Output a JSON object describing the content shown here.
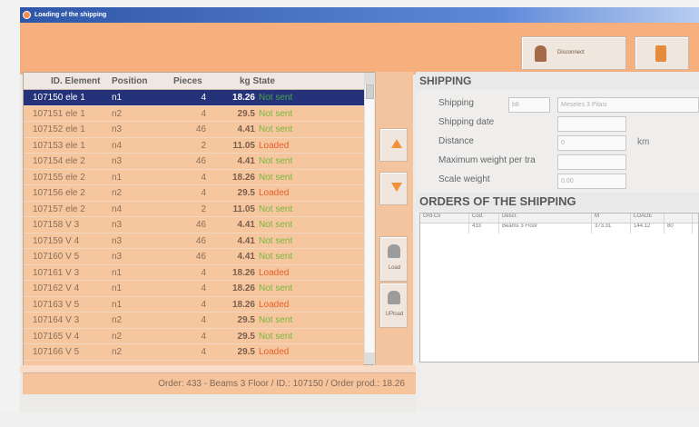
{
  "window": {
    "title": "Loading of the shipping"
  },
  "toolbar": {
    "disconnect_label": "Disconnect",
    "disconnect_icon": "disconnect-icon",
    "exit_icon": "exit-icon"
  },
  "grid": {
    "headers": [
      "ID. Element",
      "Position",
      "Pieces",
      "kg State"
    ],
    "rows": [
      {
        "id": "107150 ele 1",
        "pos": "n1",
        "pieces": "4",
        "kg": "18.26",
        "state": "Not sent",
        "selected": true
      },
      {
        "id": "107151 ele 1",
        "pos": "n2",
        "pieces": "4",
        "kg": "29.5",
        "state": "Not sent"
      },
      {
        "id": "107152 ele 1",
        "pos": "n3",
        "pieces": "46",
        "kg": "4.41",
        "state": "Not sent"
      },
      {
        "id": "107153 ele 1",
        "pos": "n4",
        "pieces": "2",
        "kg": "11.05",
        "state": "Loaded"
      },
      {
        "id": "107154 ele 2",
        "pos": "n3",
        "pieces": "46",
        "kg": "4.41",
        "state": "Not sent"
      },
      {
        "id": "107155 ele 2",
        "pos": "n1",
        "pieces": "4",
        "kg": "18.26",
        "state": "Not sent"
      },
      {
        "id": "107156 ele 2",
        "pos": "n2",
        "pieces": "4",
        "kg": "29.5",
        "state": "Loaded"
      },
      {
        "id": "107157 ele 2",
        "pos": "n4",
        "pieces": "2",
        "kg": "11.05",
        "state": "Not sent"
      },
      {
        "id": "107158 V 3",
        "pos": "n3",
        "pieces": "46",
        "kg": "4.41",
        "state": "Not sent"
      },
      {
        "id": "107159 V 4",
        "pos": "n3",
        "pieces": "46",
        "kg": "4.41",
        "state": "Not sent"
      },
      {
        "id": "107160 V 5",
        "pos": "n3",
        "pieces": "46",
        "kg": "4.41",
        "state": "Not sent"
      },
      {
        "id": "107161 V 3",
        "pos": "n1",
        "pieces": "4",
        "kg": "18.26",
        "state": "Loaded"
      },
      {
        "id": "107162 V 4",
        "pos": "n1",
        "pieces": "4",
        "kg": "18.26",
        "state": "Not sent"
      },
      {
        "id": "107163 V 5",
        "pos": "n1",
        "pieces": "4",
        "kg": "18.26",
        "state": "Loaded"
      },
      {
        "id": "107164 V 3",
        "pos": "n2",
        "pieces": "4",
        "kg": "29.5",
        "state": "Not sent"
      },
      {
        "id": "107165 V 4",
        "pos": "n2",
        "pieces": "4",
        "kg": "29.5",
        "state": "Not sent"
      },
      {
        "id": "107166 V 5",
        "pos": "n2",
        "pieces": "4",
        "kg": "29.5",
        "state": "Loaded"
      }
    ]
  },
  "side_buttons": {
    "move_up_icon": "arrow-up-icon",
    "move_down_icon": "arrow-down-icon",
    "load_label": "Load",
    "unload_label": "UPload"
  },
  "shipping": {
    "title": "SHIPPING",
    "fields": {
      "shipping_label": "Shipping",
      "shipping_code": "b8",
      "shipping_name": "Meseles 3 Pilasi",
      "date_label": "Shipping date",
      "date_value": "",
      "distance_label": "Distance",
      "distance_value": "0",
      "distance_unit": "km",
      "max_weight_label": "Maximum weight per tra",
      "max_weight_value": "",
      "scale_weight_label": "Scale weight",
      "scale_weight_value": "0.00"
    }
  },
  "orders": {
    "title": "ORDERS OF THE SHIPPING",
    "headers": [
      "Ord-Cli",
      "Cod.",
      "Descr.",
      "M",
      "LOADE",
      ""
    ],
    "rows": [
      [
        "",
        "433",
        "Beams 3 Floor",
        "373.31",
        "144.12",
        "80"
      ]
    ]
  },
  "status": {
    "text": "Order: 433 - Beams 3 Floor / ID.: 107150 / Order prod.: 18.26"
  },
  "colors": {
    "accent_orange": "#f7b07d",
    "selected_row": "#24327a",
    "not_sent": "#79b63d",
    "loaded": "#e55e2d"
  }
}
